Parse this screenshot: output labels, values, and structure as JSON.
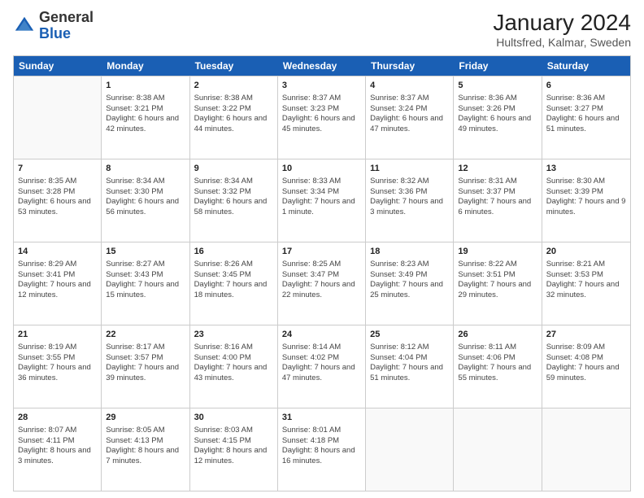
{
  "header": {
    "logo": {
      "general": "General",
      "blue": "Blue"
    },
    "title": "January 2024",
    "subtitle": "Hultsfred, Kalmar, Sweden"
  },
  "days": [
    "Sunday",
    "Monday",
    "Tuesday",
    "Wednesday",
    "Thursday",
    "Friday",
    "Saturday"
  ],
  "weeks": [
    [
      {
        "day": "",
        "empty": true
      },
      {
        "day": "1",
        "sunrise": "Sunrise: 8:38 AM",
        "sunset": "Sunset: 3:21 PM",
        "daylight": "Daylight: 6 hours and 42 minutes."
      },
      {
        "day": "2",
        "sunrise": "Sunrise: 8:38 AM",
        "sunset": "Sunset: 3:22 PM",
        "daylight": "Daylight: 6 hours and 44 minutes."
      },
      {
        "day": "3",
        "sunrise": "Sunrise: 8:37 AM",
        "sunset": "Sunset: 3:23 PM",
        "daylight": "Daylight: 6 hours and 45 minutes."
      },
      {
        "day": "4",
        "sunrise": "Sunrise: 8:37 AM",
        "sunset": "Sunset: 3:24 PM",
        "daylight": "Daylight: 6 hours and 47 minutes."
      },
      {
        "day": "5",
        "sunrise": "Sunrise: 8:36 AM",
        "sunset": "Sunset: 3:26 PM",
        "daylight": "Daylight: 6 hours and 49 minutes."
      },
      {
        "day": "6",
        "sunrise": "Sunrise: 8:36 AM",
        "sunset": "Sunset: 3:27 PM",
        "daylight": "Daylight: 6 hours and 51 minutes."
      }
    ],
    [
      {
        "day": "7",
        "sunrise": "Sunrise: 8:35 AM",
        "sunset": "Sunset: 3:28 PM",
        "daylight": "Daylight: 6 hours and 53 minutes."
      },
      {
        "day": "8",
        "sunrise": "Sunrise: 8:34 AM",
        "sunset": "Sunset: 3:30 PM",
        "daylight": "Daylight: 6 hours and 56 minutes."
      },
      {
        "day": "9",
        "sunrise": "Sunrise: 8:34 AM",
        "sunset": "Sunset: 3:32 PM",
        "daylight": "Daylight: 6 hours and 58 minutes."
      },
      {
        "day": "10",
        "sunrise": "Sunrise: 8:33 AM",
        "sunset": "Sunset: 3:34 PM",
        "daylight": "Daylight: 7 hours and 1 minute."
      },
      {
        "day": "11",
        "sunrise": "Sunrise: 8:32 AM",
        "sunset": "Sunset: 3:36 PM",
        "daylight": "Daylight: 7 hours and 3 minutes."
      },
      {
        "day": "12",
        "sunrise": "Sunrise: 8:31 AM",
        "sunset": "Sunset: 3:37 PM",
        "daylight": "Daylight: 7 hours and 6 minutes."
      },
      {
        "day": "13",
        "sunrise": "Sunrise: 8:30 AM",
        "sunset": "Sunset: 3:39 PM",
        "daylight": "Daylight: 7 hours and 9 minutes."
      }
    ],
    [
      {
        "day": "14",
        "sunrise": "Sunrise: 8:29 AM",
        "sunset": "Sunset: 3:41 PM",
        "daylight": "Daylight: 7 hours and 12 minutes."
      },
      {
        "day": "15",
        "sunrise": "Sunrise: 8:27 AM",
        "sunset": "Sunset: 3:43 PM",
        "daylight": "Daylight: 7 hours and 15 minutes."
      },
      {
        "day": "16",
        "sunrise": "Sunrise: 8:26 AM",
        "sunset": "Sunset: 3:45 PM",
        "daylight": "Daylight: 7 hours and 18 minutes."
      },
      {
        "day": "17",
        "sunrise": "Sunrise: 8:25 AM",
        "sunset": "Sunset: 3:47 PM",
        "daylight": "Daylight: 7 hours and 22 minutes."
      },
      {
        "day": "18",
        "sunrise": "Sunrise: 8:23 AM",
        "sunset": "Sunset: 3:49 PM",
        "daylight": "Daylight: 7 hours and 25 minutes."
      },
      {
        "day": "19",
        "sunrise": "Sunrise: 8:22 AM",
        "sunset": "Sunset: 3:51 PM",
        "daylight": "Daylight: 7 hours and 29 minutes."
      },
      {
        "day": "20",
        "sunrise": "Sunrise: 8:21 AM",
        "sunset": "Sunset: 3:53 PM",
        "daylight": "Daylight: 7 hours and 32 minutes."
      }
    ],
    [
      {
        "day": "21",
        "sunrise": "Sunrise: 8:19 AM",
        "sunset": "Sunset: 3:55 PM",
        "daylight": "Daylight: 7 hours and 36 minutes."
      },
      {
        "day": "22",
        "sunrise": "Sunrise: 8:17 AM",
        "sunset": "Sunset: 3:57 PM",
        "daylight": "Daylight: 7 hours and 39 minutes."
      },
      {
        "day": "23",
        "sunrise": "Sunrise: 8:16 AM",
        "sunset": "Sunset: 4:00 PM",
        "daylight": "Daylight: 7 hours and 43 minutes."
      },
      {
        "day": "24",
        "sunrise": "Sunrise: 8:14 AM",
        "sunset": "Sunset: 4:02 PM",
        "daylight": "Daylight: 7 hours and 47 minutes."
      },
      {
        "day": "25",
        "sunrise": "Sunrise: 8:12 AM",
        "sunset": "Sunset: 4:04 PM",
        "daylight": "Daylight: 7 hours and 51 minutes."
      },
      {
        "day": "26",
        "sunrise": "Sunrise: 8:11 AM",
        "sunset": "Sunset: 4:06 PM",
        "daylight": "Daylight: 7 hours and 55 minutes."
      },
      {
        "day": "27",
        "sunrise": "Sunrise: 8:09 AM",
        "sunset": "Sunset: 4:08 PM",
        "daylight": "Daylight: 7 hours and 59 minutes."
      }
    ],
    [
      {
        "day": "28",
        "sunrise": "Sunrise: 8:07 AM",
        "sunset": "Sunset: 4:11 PM",
        "daylight": "Daylight: 8 hours and 3 minutes."
      },
      {
        "day": "29",
        "sunrise": "Sunrise: 8:05 AM",
        "sunset": "Sunset: 4:13 PM",
        "daylight": "Daylight: 8 hours and 7 minutes."
      },
      {
        "day": "30",
        "sunrise": "Sunrise: 8:03 AM",
        "sunset": "Sunset: 4:15 PM",
        "daylight": "Daylight: 8 hours and 12 minutes."
      },
      {
        "day": "31",
        "sunrise": "Sunrise: 8:01 AM",
        "sunset": "Sunset: 4:18 PM",
        "daylight": "Daylight: 8 hours and 16 minutes."
      },
      {
        "day": "",
        "empty": true
      },
      {
        "day": "",
        "empty": true
      },
      {
        "day": "",
        "empty": true
      }
    ]
  ]
}
